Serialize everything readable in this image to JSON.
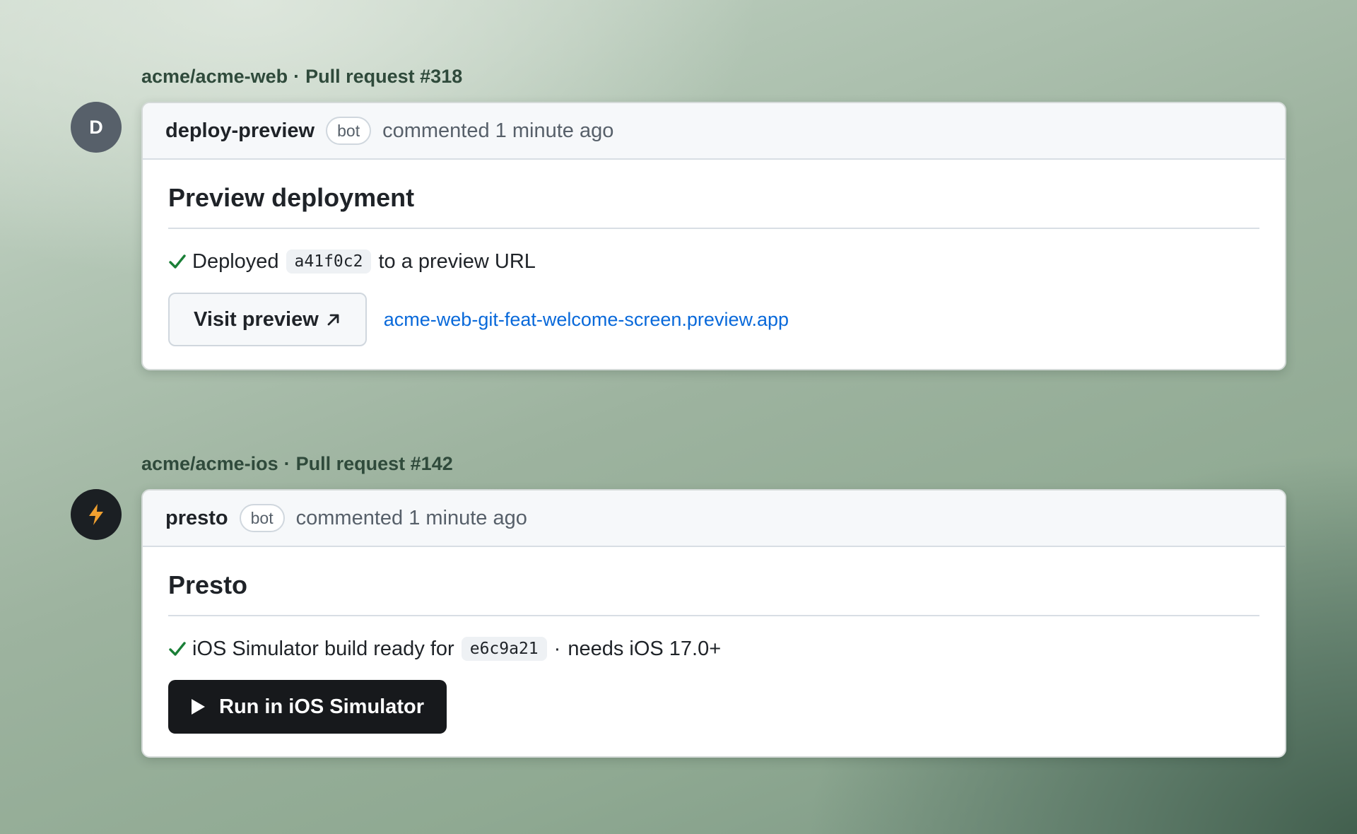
{
  "colors": {
    "check": "#1a7f37",
    "link": "#0969da",
    "bolt": "#f0a030",
    "dark_button": "#17191c"
  },
  "threads": [
    {
      "repo": "acme/acme-web",
      "separator": "·",
      "pull_request": "Pull request #318",
      "avatar": {
        "letter": "D"
      },
      "author": "deploy-preview",
      "badge": "bot",
      "meta": "commented 1 minute ago",
      "title": "Preview deployment",
      "status": {
        "icon": "check-icon",
        "before": "Deployed",
        "code": "a41f0c2",
        "after": "to a preview URL"
      },
      "button": {
        "label": "Visit preview",
        "icon": "arrow-up-right-icon"
      },
      "link": "acme-web-git-feat-welcome-screen.preview.app"
    },
    {
      "repo": "acme/acme-ios",
      "separator": "·",
      "pull_request": "Pull request #142",
      "avatar": {
        "icon": "lightning-bolt-icon"
      },
      "author": "presto",
      "badge": "bot",
      "meta": "commented 1 minute ago",
      "title": "Presto",
      "status": {
        "icon": "check-icon",
        "before": "iOS Simulator build ready for",
        "code": "e6c9a21",
        "separator": "·",
        "after": "needs iOS 17.0+"
      },
      "button": {
        "label": "Run in iOS Simulator",
        "icon": "play-icon"
      }
    }
  ]
}
